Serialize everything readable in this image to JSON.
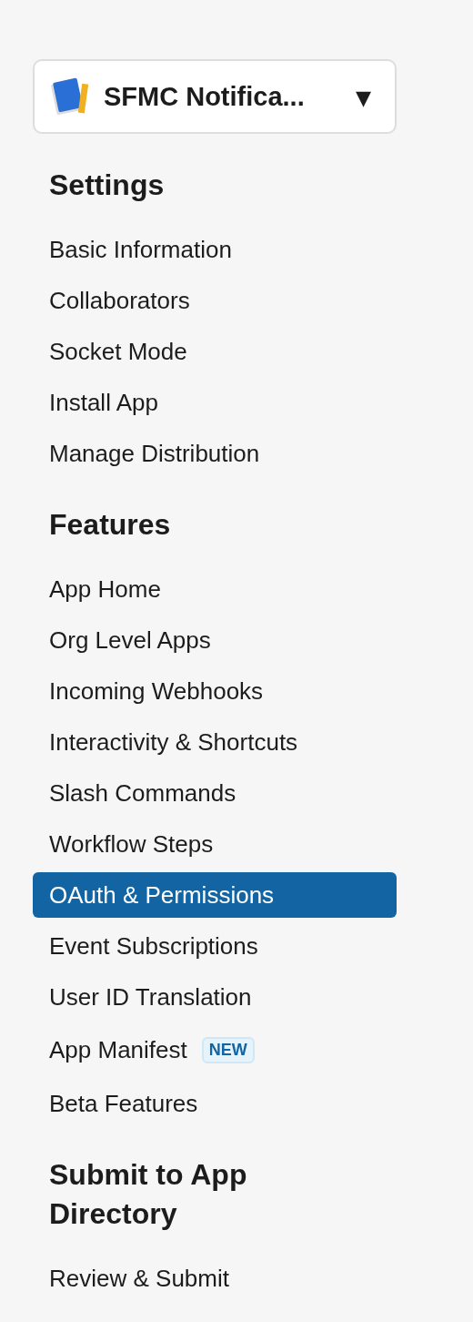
{
  "app_selector": {
    "name": "SFMC Notifica...",
    "caret": "▾"
  },
  "sections": [
    {
      "heading": "Settings",
      "items": [
        {
          "label": "Basic Information",
          "selected": false
        },
        {
          "label": "Collaborators",
          "selected": false
        },
        {
          "label": "Socket Mode",
          "selected": false
        },
        {
          "label": "Install App",
          "selected": false
        },
        {
          "label": "Manage Distribution",
          "selected": false
        }
      ]
    },
    {
      "heading": "Features",
      "items": [
        {
          "label": "App Home",
          "selected": false
        },
        {
          "label": "Org Level Apps",
          "selected": false
        },
        {
          "label": "Incoming Webhooks",
          "selected": false
        },
        {
          "label": "Interactivity & Shortcuts",
          "selected": false
        },
        {
          "label": "Slash Commands",
          "selected": false
        },
        {
          "label": "Workflow Steps",
          "selected": false
        },
        {
          "label": "OAuth & Permissions",
          "selected": true
        },
        {
          "label": "Event Subscriptions",
          "selected": false
        },
        {
          "label": "User ID Translation",
          "selected": false
        },
        {
          "label": "App Manifest",
          "selected": false,
          "badge": "NEW"
        },
        {
          "label": "Beta Features",
          "selected": false
        }
      ]
    },
    {
      "heading": "Submit to App Directory",
      "items": [
        {
          "label": "Review & Submit",
          "selected": false
        }
      ]
    }
  ]
}
